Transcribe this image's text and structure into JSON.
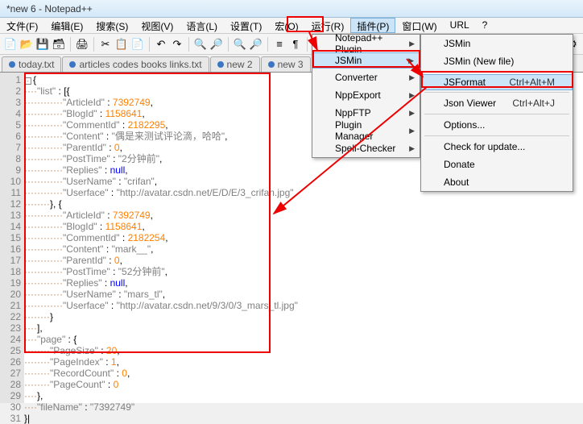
{
  "title": "*new 6 - Notepad++",
  "menu": {
    "file": "文件(F)",
    "edit": "编辑(E)",
    "search": "搜索(S)",
    "view": "视图(V)",
    "lang": "语言(L)",
    "settings": "设置(T)",
    "macro": "宏(O)",
    "run": "运行(R)",
    "plugins": "插件(P)",
    "window": "窗口(W)",
    "url": "URL",
    "help": "?"
  },
  "tabs": [
    {
      "label": "today.txt"
    },
    {
      "label": "articles codes books links.txt"
    },
    {
      "label": "new 2"
    },
    {
      "label": "new 3"
    }
  ],
  "plugmenu": {
    "npp_plugin": "Notepad++ Plugin",
    "jsmin": "JSMin",
    "converter": "Converter",
    "nppexport": "NppExport",
    "nppftp": "NppFTP",
    "plugin_mgr": "Plugin Manager",
    "spell": "Spell-Checker"
  },
  "jsminmenu": {
    "jsmin": "JSMin",
    "jsmin_new": "JSMin (New file)",
    "jsformat": "JSFormat",
    "jsformat_sc": "Ctrl+Alt+M",
    "json_viewer": "Json Viewer",
    "json_sc": "Ctrl+Alt+J",
    "options": "Options...",
    "check": "Check for update...",
    "donate": "Donate",
    "about": "About"
  },
  "code": [
    "⊟{",
    "····\"list\" : [{",
    "············\"ArticleId\" : 7392749,",
    "············\"BlogId\" : 1158641,",
    "············\"CommentId\" : 2182295,",
    "············\"Content\" : \"偶是来测试评论滴，哈哈\",",
    "············\"ParentId\" : 0,",
    "············\"PostTime\" : \"2分钟前\",",
    "············\"Replies\" : null,",
    "············\"UserName\" : \"crifan\",",
    "············\"Userface\" : \"http://avatar.csdn.net/E/D/E/3_crifan.jpg\"",
    "········}, {",
    "············\"ArticleId\" : 7392749,",
    "············\"BlogId\" : 1158641,",
    "············\"CommentId\" : 2182254,",
    "············\"Content\" : \"mark__\",",
    "············\"ParentId\" : 0,",
    "············\"PostTime\" : \"52分钟前\",",
    "············\"Replies\" : null,",
    "············\"UserName\" : \"mars_tl\",",
    "············\"Userface\" : \"http://avatar.csdn.net/9/3/0/3_mars_tl.jpg\"",
    "········}",
    "····],",
    "····\"page\" : {",
    "········\"PageSize\" : 20,",
    "········\"PageIndex\" : 1,",
    "········\"RecordCount\" : 0,",
    "········\"PageCount\" : 0",
    "····},",
    "····\"fileName\" : \"7392749\"",
    "}|"
  ]
}
